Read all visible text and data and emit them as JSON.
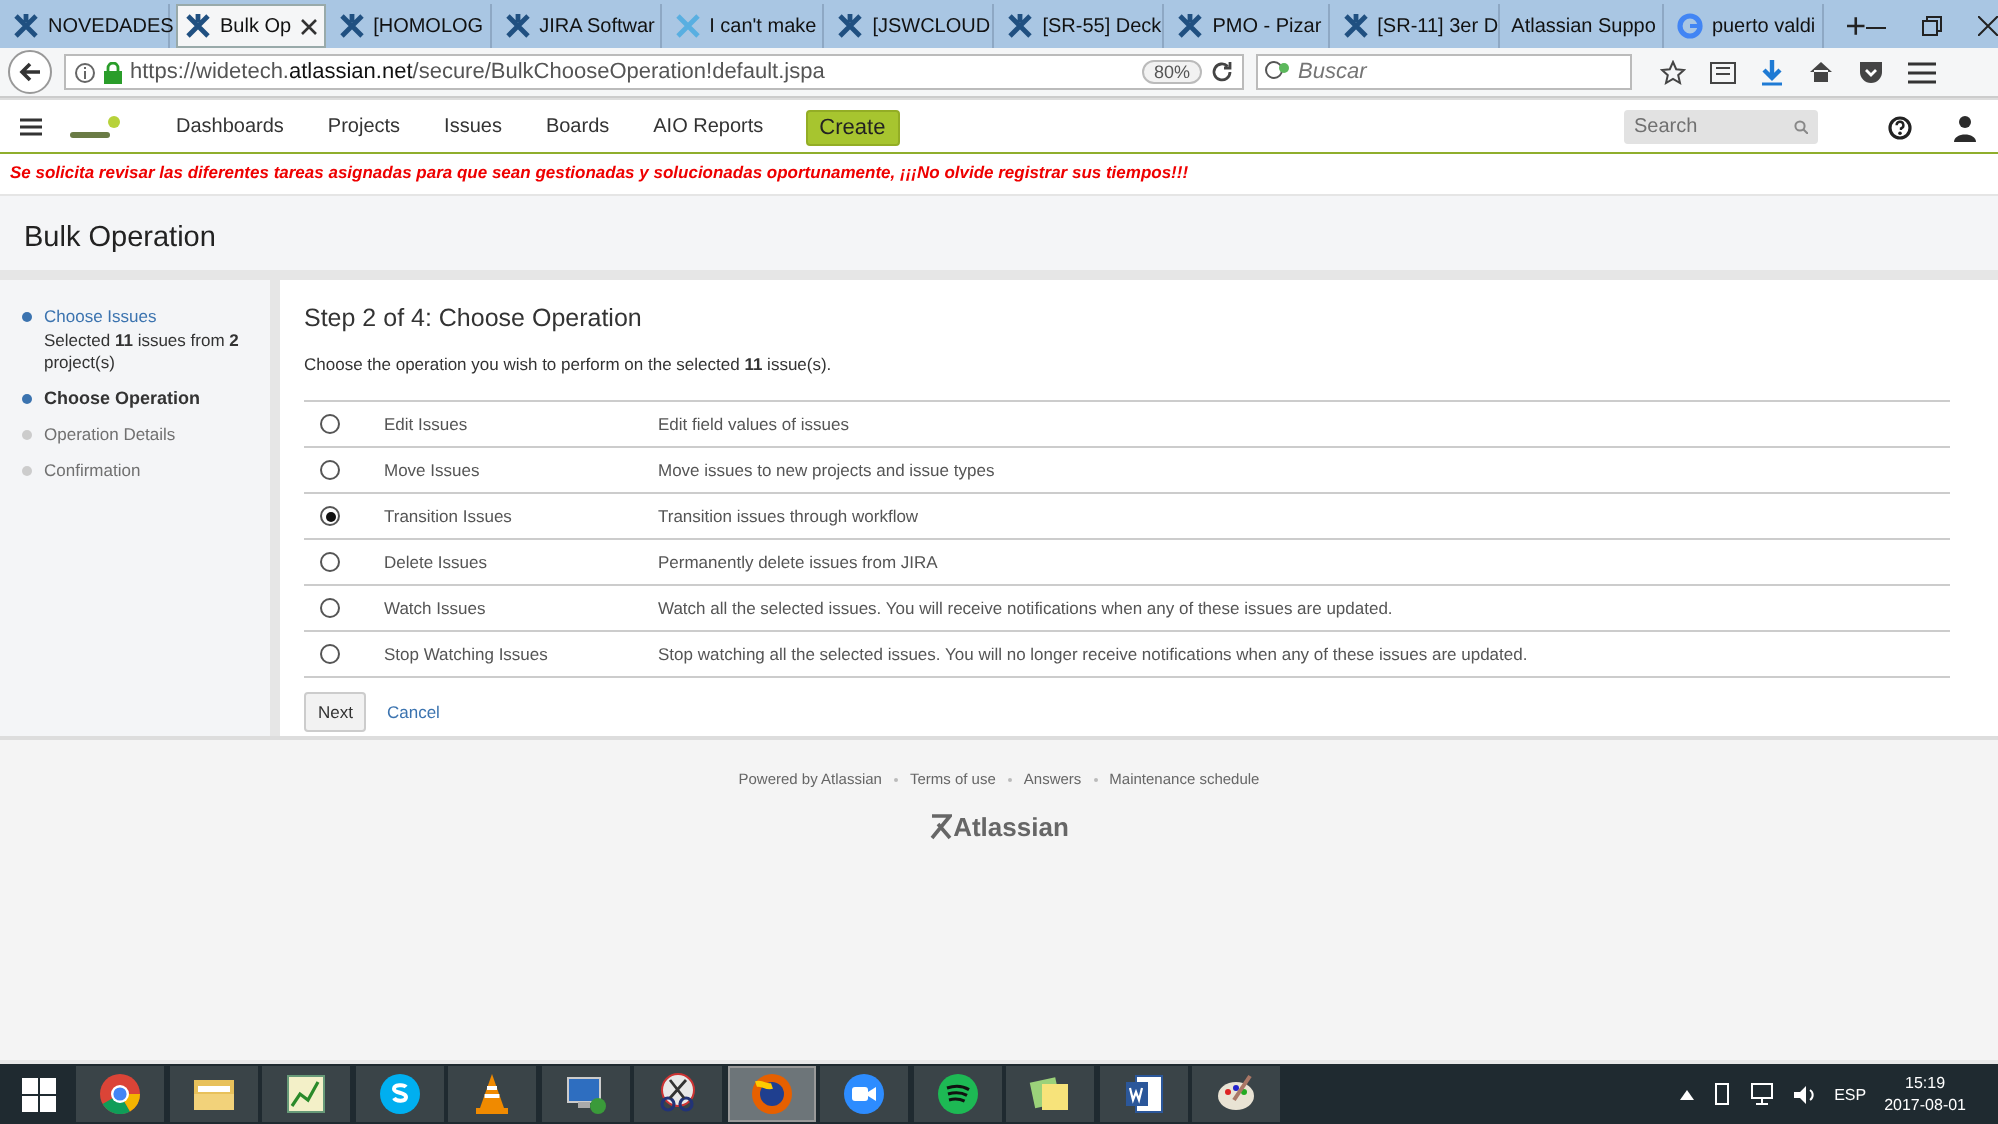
{
  "browser": {
    "tabs": [
      {
        "title": "NOVEDADES",
        "kind": "jira",
        "selected": false
      },
      {
        "title": "Bulk Op",
        "kind": "jira",
        "selected": true
      },
      {
        "title": "[HOMOLOG",
        "kind": "jira",
        "selected": false
      },
      {
        "title": "JIRA Softwar",
        "kind": "jira",
        "selected": false
      },
      {
        "title": "I can't make",
        "kind": "community",
        "selected": false
      },
      {
        "title": "[JSWCLOUD",
        "kind": "jira",
        "selected": false
      },
      {
        "title": "[SR-55] Deck",
        "kind": "jira",
        "selected": false
      },
      {
        "title": "PMO - Pizar",
        "kind": "jira",
        "selected": false
      },
      {
        "title": "[SR-11] 3er D",
        "kind": "jira",
        "selected": false
      },
      {
        "title": "Atlassian Suppo",
        "kind": "plain",
        "selected": false
      },
      {
        "title": "puerto valdi",
        "kind": "google",
        "selected": false
      }
    ],
    "new_tab": "+",
    "url": "https://widetech.**atlassian.net**/secure/BulkChooseOperation!default.jspa",
    "zoom": "80%",
    "search": {
      "placeholder": "Buscar"
    }
  },
  "header": {
    "nav": [
      "Dashboards",
      "Projects",
      "Issues",
      "Boards",
      "AIO Reports"
    ],
    "create": "Create",
    "search": {
      "placeholder": "Search"
    }
  },
  "banner": "Se solicita revisar las diferentes tareas asignadas para que sean gestionadas y solucionadas oportunamente, ¡¡¡No olvide registrar sus tiempos!!!",
  "page_title": "Bulk Operation",
  "steps": [
    {
      "label": "Choose Issues",
      "kind": "done",
      "detail": "Selected **11** issues from **2** project(s)"
    },
    {
      "label": "Choose Operation",
      "kind": "current"
    },
    {
      "label": "Operation Details",
      "kind": "pending"
    },
    {
      "label": "Confirmation",
      "kind": "pending"
    }
  ],
  "heading": "Step 2 of 4: Choose Operation",
  "intro": "Choose the operation you wish to perform on the selected **11** issue(s).",
  "operations": [
    {
      "name": "Edit Issues",
      "description": "Edit field values of issues",
      "selected": false
    },
    {
      "name": "Move Issues",
      "description": "Move issues to new projects and issue types",
      "selected": false
    },
    {
      "name": "Transition Issues",
      "description": "Transition issues through workflow",
      "selected": true
    },
    {
      "name": "Delete Issues",
      "description": "Permanently delete issues from JIRA",
      "selected": false
    },
    {
      "name": "Watch Issues",
      "description": "Watch all the selected issues. You will receive notifications when any of these issues are updated.",
      "selected": false
    },
    {
      "name": "Stop Watching Issues",
      "description": "Stop watching all the selected issues. You will no longer receive notifications when any of these issues are updated.",
      "selected": false
    }
  ],
  "buttons": {
    "next": "Next",
    "cancel": "Cancel"
  },
  "footer": {
    "links": [
      "Powered by Atlassian",
      "Terms of use",
      "Answers",
      "Maintenance schedule"
    ],
    "logo": "Atlassian"
  },
  "taskbar": {
    "apps": [
      {
        "kind": "chrome",
        "selected": false
      },
      {
        "kind": "folder",
        "selected": false
      },
      {
        "kind": "chart",
        "selected": false
      },
      {
        "kind": "skype",
        "selected": false
      },
      {
        "kind": "cone",
        "selected": false
      },
      {
        "kind": "monitor",
        "selected": false
      },
      {
        "kind": "scissors",
        "selected": false
      },
      {
        "kind": "firefox",
        "selected": true
      },
      {
        "kind": "camera",
        "selected": false
      },
      {
        "kind": "spotify",
        "selected": false
      },
      {
        "kind": "notes",
        "selected": false
      },
      {
        "kind": "word",
        "selected": false
      },
      {
        "kind": "palette",
        "selected": false
      }
    ],
    "language": "ESP",
    "time": "15:19",
    "date": "2017-08-01"
  }
}
